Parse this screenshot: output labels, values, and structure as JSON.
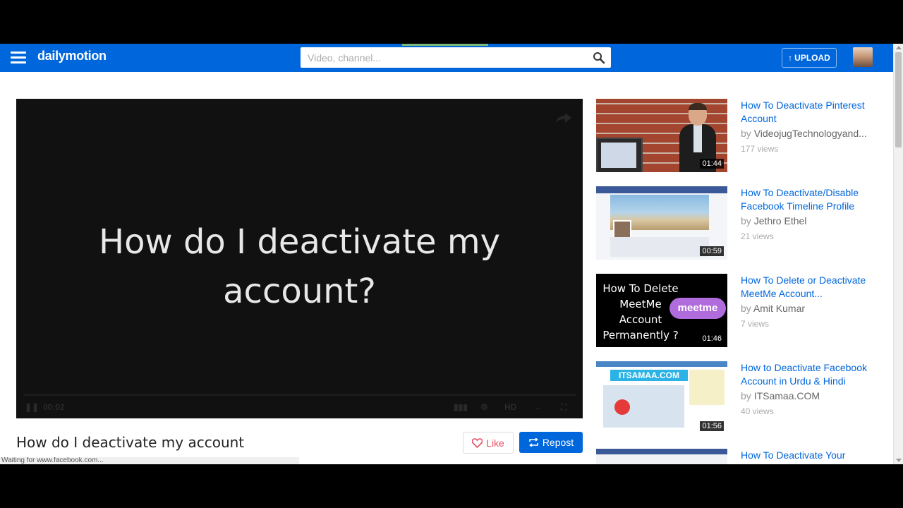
{
  "header": {
    "logo": "dailymotion",
    "search_placeholder": "Video, channel...",
    "upload_label": "UPLOAD"
  },
  "player": {
    "title_line1": "How do I deactivate my",
    "title_line2": "account?",
    "time": "00:02",
    "quality": "HD"
  },
  "video": {
    "title": "How do I deactivate my account",
    "like_label": "Like",
    "repost_label": "Repost"
  },
  "status_text": "Waiting for www.facebook.com...",
  "related": [
    {
      "title": "How To Deactivate Pinterest Account",
      "by": "by",
      "channel": "VideojugTechnologyand...",
      "views": "177 views",
      "duration": "01:44"
    },
    {
      "title": "How To Deactivate/Disable Facebook Timeline Profile",
      "by": "by",
      "channel": "Jethro Ethel",
      "views": "21 views",
      "duration": "00:59"
    },
    {
      "title": "How To Delete or Deactivate MeetMe Account...",
      "by": "by",
      "channel": "Amit Kumar",
      "views": "7 views",
      "duration": "01:46",
      "thumb_text": "How To Delete MeetMe Account Permanently ?",
      "thumb_badge": "meetme"
    },
    {
      "title": "How to Deactivate Facebook Account in Urdu & Hindi",
      "by": "by",
      "channel": "ITSamaa.COM",
      "views": "40 views",
      "duration": "01:56",
      "thumb_logo": "ITSAMAA.COM"
    },
    {
      "title": "How To Deactivate Your"
    }
  ],
  "colors": {
    "brand_blue": "#0066dc",
    "like_red": "#e94f63"
  }
}
